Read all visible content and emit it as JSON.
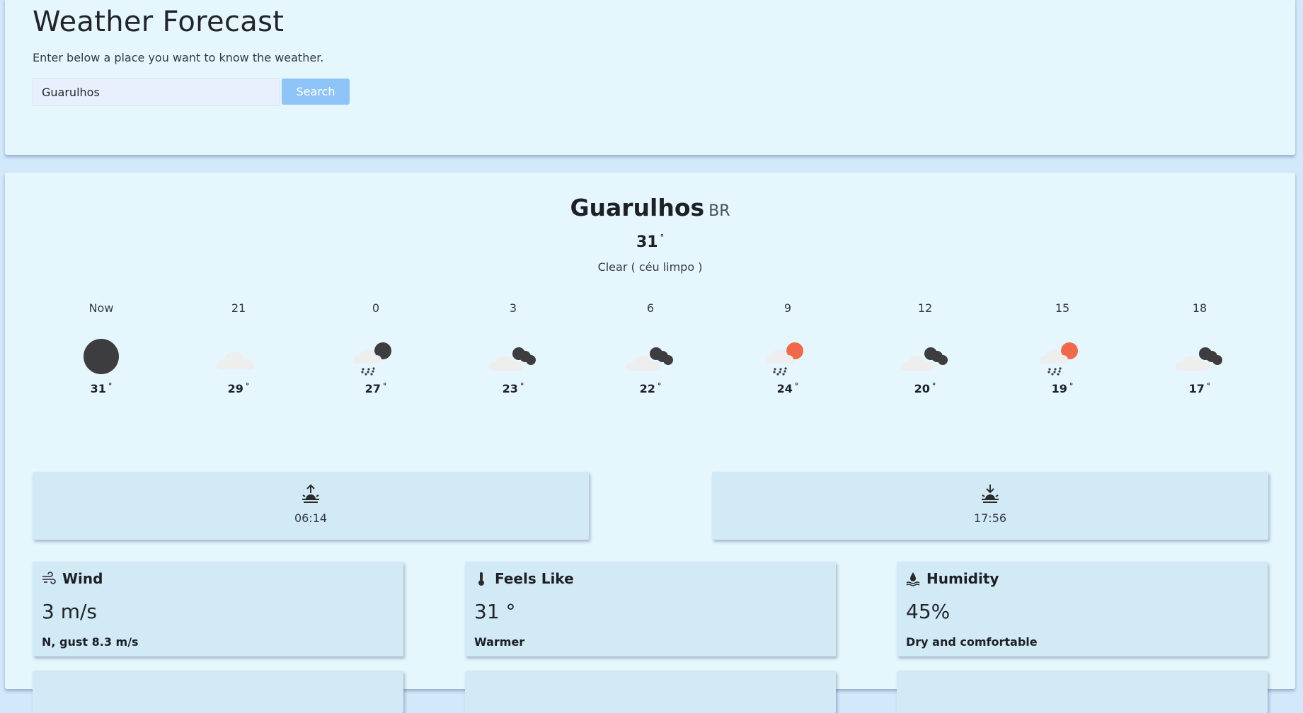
{
  "header": {
    "title": "Weather Forecast",
    "subtitle": "Enter below a place you want to know the weather.",
    "search_value": "Guarulhos",
    "search_button": "Search"
  },
  "current": {
    "city": "Guarulhos",
    "country": "BR",
    "temp": "31",
    "degree": "°",
    "description": "Clear ( céu limpo )"
  },
  "forecast": [
    {
      "time": "Now",
      "temp": "31",
      "icon": "clear-night-icon"
    },
    {
      "time": "21",
      "temp": "29",
      "icon": "cloud-icon"
    },
    {
      "time": "0",
      "temp": "27",
      "icon": "night-rain-icon"
    },
    {
      "time": "3",
      "temp": "23",
      "icon": "cloudy-night-icon"
    },
    {
      "time": "6",
      "temp": "22",
      "icon": "cloudy-night-icon"
    },
    {
      "time": "9",
      "temp": "24",
      "icon": "day-rain-icon"
    },
    {
      "time": "12",
      "temp": "20",
      "icon": "cloudy-night-icon"
    },
    {
      "time": "15",
      "temp": "19",
      "icon": "day-rain-icon"
    },
    {
      "time": "18",
      "temp": "17",
      "icon": "cloudy-night-icon"
    }
  ],
  "sun": {
    "sunrise": "06:14",
    "sunset": "17:56"
  },
  "stats": {
    "wind": {
      "title": "Wind",
      "value": "3 m/s",
      "note": "N, gust 8.3 m/s"
    },
    "feels_like": {
      "title": "Feels Like",
      "value": "31 °",
      "note": "Warmer"
    },
    "humidity": {
      "title": "Humidity",
      "value": "45%",
      "note": "Dry and comfortable"
    }
  },
  "colors": {
    "page_bg": "#d2e8fb",
    "card_bg": "#e6f6fd",
    "box_bg": "#d2e9f6",
    "button": "#8ec4f8",
    "icon_dark": "#3d3d3f",
    "cloud": "#eeeeee",
    "sun": "#ef6a4a"
  }
}
